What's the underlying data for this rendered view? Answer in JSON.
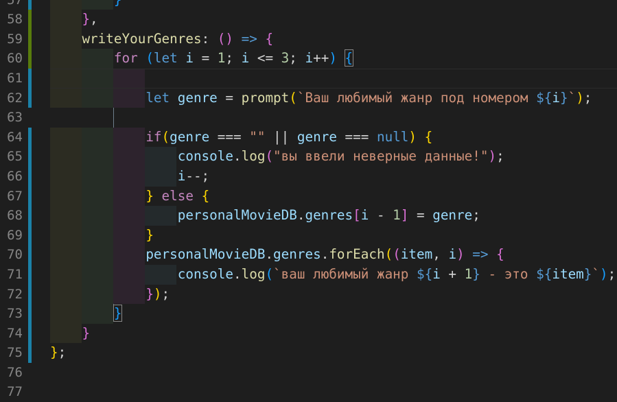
{
  "colors": {
    "background": "#1e1e1e",
    "indent": [
      "#2c2c22",
      "#262d26",
      "#2d232d",
      "#242a2c"
    ],
    "gutter_modified_green": "#587c0c",
    "gutter_modified_blue": "#1b81a8"
  },
  "current_line": 61,
  "bracket_match": {
    "open_line": 60,
    "close_line": 73
  },
  "lines": [
    {
      "n": "57",
      "indent": 2,
      "gutter": "blue",
      "tokens": [
        [
          "        }",
          "b3"
        ]
      ]
    },
    {
      "n": "58",
      "indent": 1,
      "gutter": "green",
      "tokens": [
        [
          "    ",
          "op"
        ],
        [
          "}",
          "b2"
        ],
        [
          ",",
          "op"
        ]
      ]
    },
    {
      "n": "59",
      "indent": 1,
      "gutter": "green",
      "tokens": [
        [
          "    ",
          "op"
        ],
        [
          "writeYourGenres",
          "fn"
        ],
        [
          ": ",
          "op"
        ],
        [
          "()",
          "b2"
        ],
        [
          " ",
          "op"
        ],
        [
          "=>",
          "st"
        ],
        [
          " ",
          "op"
        ],
        [
          "{",
          "b2"
        ]
      ]
    },
    {
      "n": "60",
      "indent": 2,
      "gutter": "green",
      "tokens": [
        [
          "        ",
          "op"
        ],
        [
          "for",
          "kw"
        ],
        [
          " ",
          "op"
        ],
        [
          "(",
          "b3"
        ],
        [
          "let",
          "st"
        ],
        [
          " ",
          "op"
        ],
        [
          "i",
          "var"
        ],
        [
          " = ",
          "op"
        ],
        [
          "1",
          "num"
        ],
        [
          "; ",
          "op"
        ],
        [
          "i",
          "var"
        ],
        [
          " <= ",
          "op"
        ],
        [
          "3",
          "num"
        ],
        [
          "; ",
          "op"
        ],
        [
          "i",
          "var"
        ],
        [
          "++",
          "op"
        ],
        [
          ")",
          "b3"
        ],
        [
          " ",
          "op"
        ],
        [
          "{",
          "b3 match"
        ]
      ]
    },
    {
      "n": "61",
      "indent": 3,
      "gutter": "blue",
      "tokens": []
    },
    {
      "n": "62",
      "indent": 3,
      "gutter": "blue",
      "tokens": [
        [
          "            ",
          "op"
        ],
        [
          "let",
          "st"
        ],
        [
          " ",
          "op"
        ],
        [
          "genre",
          "var"
        ],
        [
          " = ",
          "op"
        ],
        [
          "prompt",
          "fn"
        ],
        [
          "(",
          "b1"
        ],
        [
          "`Ваш любимый жанр под номером ",
          "str"
        ],
        [
          "${",
          "st"
        ],
        [
          "i",
          "var"
        ],
        [
          "}",
          "st"
        ],
        [
          "`",
          "str"
        ],
        [
          ")",
          "b1"
        ],
        [
          ";",
          "op"
        ]
      ]
    },
    {
      "n": "63",
      "indent": 0,
      "gutter": "",
      "tokens": []
    },
    {
      "n": "64",
      "indent": 3,
      "gutter": "blue",
      "tokens": [
        [
          "            ",
          "op"
        ],
        [
          "if",
          "kw"
        ],
        [
          "(",
          "b1"
        ],
        [
          "genre",
          "var"
        ],
        [
          " === ",
          "op"
        ],
        [
          "\"\"",
          "str"
        ],
        [
          " || ",
          "op"
        ],
        [
          "genre",
          "var"
        ],
        [
          " === ",
          "op"
        ],
        [
          "null",
          "st"
        ],
        [
          ")",
          "b1"
        ],
        [
          " ",
          "op"
        ],
        [
          "{",
          "b1"
        ]
      ]
    },
    {
      "n": "65",
      "indent": 4,
      "gutter": "blue",
      "tokens": [
        [
          "                ",
          "op"
        ],
        [
          "console",
          "var"
        ],
        [
          ".",
          "op"
        ],
        [
          "log",
          "fn"
        ],
        [
          "(",
          "b2"
        ],
        [
          "\"вы ввели неверные данные!\"",
          "str"
        ],
        [
          ")",
          "b2"
        ],
        [
          ";",
          "op"
        ]
      ]
    },
    {
      "n": "66",
      "indent": 4,
      "gutter": "blue",
      "tokens": [
        [
          "                ",
          "op"
        ],
        [
          "i",
          "var"
        ],
        [
          "--;",
          "op"
        ]
      ]
    },
    {
      "n": "67",
      "indent": 3,
      "gutter": "blue",
      "tokens": [
        [
          "            ",
          "op"
        ],
        [
          "}",
          "b1"
        ],
        [
          " ",
          "op"
        ],
        [
          "else",
          "kw"
        ],
        [
          " ",
          "op"
        ],
        [
          "{",
          "b1"
        ]
      ]
    },
    {
      "n": "68",
      "indent": 4,
      "gutter": "blue",
      "tokens": [
        [
          "                ",
          "op"
        ],
        [
          "personalMovieDB",
          "var"
        ],
        [
          ".",
          "op"
        ],
        [
          "genres",
          "var"
        ],
        [
          "[",
          "b2"
        ],
        [
          "i",
          "var"
        ],
        [
          " - ",
          "op"
        ],
        [
          "1",
          "num"
        ],
        [
          "]",
          "b2"
        ],
        [
          " = ",
          "op"
        ],
        [
          "genre",
          "var"
        ],
        [
          ";",
          "op"
        ]
      ]
    },
    {
      "n": "69",
      "indent": 3,
      "gutter": "blue",
      "tokens": [
        [
          "            ",
          "op"
        ],
        [
          "}",
          "b1"
        ]
      ]
    },
    {
      "n": "70",
      "indent": 3,
      "gutter": "blue",
      "tokens": [
        [
          "            ",
          "op"
        ],
        [
          "personalMovieDB",
          "var"
        ],
        [
          ".",
          "op"
        ],
        [
          "genres",
          "var"
        ],
        [
          ".",
          "op"
        ],
        [
          "forEach",
          "fn"
        ],
        [
          "(",
          "b1"
        ],
        [
          "(",
          "b2"
        ],
        [
          "item",
          "var"
        ],
        [
          ", ",
          "op"
        ],
        [
          "i",
          "var"
        ],
        [
          ")",
          "b2"
        ],
        [
          " ",
          "op"
        ],
        [
          "=>",
          "st"
        ],
        [
          " ",
          "op"
        ],
        [
          "{",
          "b2"
        ]
      ]
    },
    {
      "n": "71",
      "indent": 4,
      "gutter": "blue",
      "tokens": [
        [
          "                ",
          "op"
        ],
        [
          "console",
          "var"
        ],
        [
          ".",
          "op"
        ],
        [
          "log",
          "fn"
        ],
        [
          "(",
          "b3"
        ],
        [
          "`ваш любимый жанр ",
          "str"
        ],
        [
          "${",
          "st"
        ],
        [
          "i",
          "var"
        ],
        [
          " + ",
          "op"
        ],
        [
          "1",
          "num"
        ],
        [
          "}",
          "st"
        ],
        [
          " - это ",
          "str"
        ],
        [
          "${",
          "st"
        ],
        [
          "item",
          "var"
        ],
        [
          "}",
          "st"
        ],
        [
          "`",
          "str"
        ],
        [
          ")",
          "b3"
        ],
        [
          ";",
          "op"
        ]
      ]
    },
    {
      "n": "72",
      "indent": 3,
      "gutter": "blue",
      "tokens": [
        [
          "            ",
          "op"
        ],
        [
          "}",
          "b2"
        ],
        [
          ")",
          "b1"
        ],
        [
          ";",
          "op"
        ]
      ]
    },
    {
      "n": "73",
      "indent": 2,
      "gutter": "blue",
      "tokens": [
        [
          "        ",
          "op"
        ],
        [
          "}",
          "b3 match"
        ]
      ]
    },
    {
      "n": "74",
      "indent": 1,
      "gutter": "blue",
      "tokens": [
        [
          "    ",
          "op"
        ],
        [
          "}",
          "b2"
        ]
      ]
    },
    {
      "n": "75",
      "indent": 0,
      "gutter": "blue",
      "tokens": [
        [
          "}",
          "b1"
        ],
        [
          ";",
          "op"
        ]
      ]
    },
    {
      "n": "76",
      "indent": 0,
      "gutter": "",
      "tokens": []
    },
    {
      "n": "77",
      "indent": 0,
      "gutter": "",
      "tokens": []
    }
  ]
}
